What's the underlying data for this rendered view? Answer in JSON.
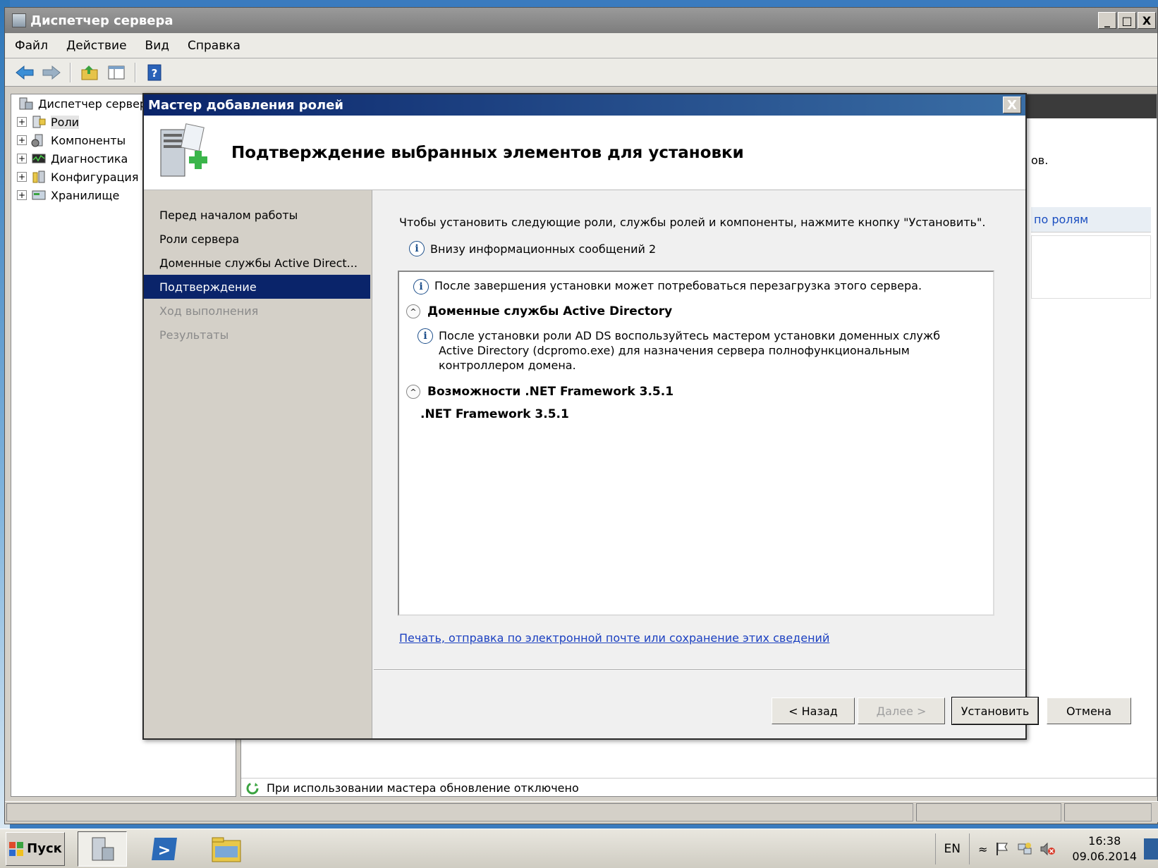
{
  "window": {
    "title": "Диспетчер сервера",
    "minimize": "_",
    "maximize": "□",
    "close": "X"
  },
  "menu": [
    "Файл",
    "Действие",
    "Вид",
    "Справка"
  ],
  "toolbar_icons": [
    "back-arrow-icon",
    "forward-arrow-icon",
    "up-folder-icon",
    "show-hide-tree-icon",
    "help-icon"
  ],
  "tree": {
    "root": "Диспетчер сервер",
    "items": [
      {
        "label": "Роли",
        "icon": "roles-icon"
      },
      {
        "label": "Компоненты",
        "icon": "features-icon"
      },
      {
        "label": "Диагностика",
        "icon": "diagnostics-icon"
      },
      {
        "label": "Конфигурация",
        "icon": "configuration-icon"
      },
      {
        "label": "Хранилище",
        "icon": "storage-icon"
      }
    ]
  },
  "right_panel": {
    "snippet": "ов.",
    "link_fragment": "по ролям",
    "refresh_status": "При использовании мастера обновление отключено"
  },
  "dialog": {
    "title": "Мастер добавления ролей",
    "close": "X",
    "heading": "Подтверждение выбранных элементов для установки",
    "steps": [
      {
        "label": "Перед началом работы",
        "state": "normal"
      },
      {
        "label": "Роли сервера",
        "state": "normal"
      },
      {
        "label": "Доменные службы Active Direct...",
        "state": "normal"
      },
      {
        "label": "Подтверждение",
        "state": "active"
      },
      {
        "label": "Ход выполнения",
        "state": "disabled"
      },
      {
        "label": "Результаты",
        "state": "disabled"
      }
    ],
    "intro": "Чтобы установить следующие роли, службы ролей и компоненты, нажмите кнопку \"Установить\".",
    "info_count": "Внизу информационных сообщений 2",
    "info_glyph": "i",
    "collapse_glyph": "^",
    "details": {
      "restart_note": "После завершения установки может потребоваться перезагрузка этого сервера.",
      "section_adds": "Доменные службы Active Directory",
      "adds_note": "После установки роли AD DS воспользуйтесь мастером установки доменных служб Active Directory (dcpromo.exe) для назначения сервера полнофункциональным контроллером домена.",
      "section_net": "Возможности .NET Framework 3.5.1",
      "net_item": ".NET Framework 3.5.1"
    },
    "print_link": "Печать, отправка по электронной почте или сохранение этих сведений",
    "buttons": {
      "back": "< Назад",
      "next": "Далее >",
      "install": "Установить",
      "cancel": "Отмена"
    }
  },
  "taskbar": {
    "start": "Пуск",
    "language": "EN",
    "tray_expand": "≈",
    "time": "16:38",
    "date": "09.06.2014"
  },
  "colors": {
    "dialog_title_start": "#0a246a",
    "dialog_title_end": "#3a6ea5",
    "active_step": "#0a246a",
    "link": "#1a3fc0"
  }
}
